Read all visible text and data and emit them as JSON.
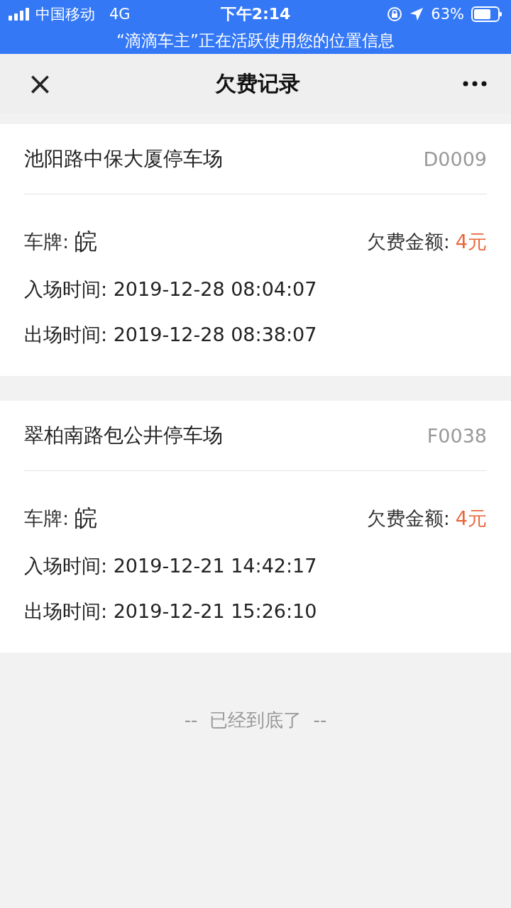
{
  "status_bar": {
    "carrier": "中国移动",
    "network": "4G",
    "time": "下午2:14",
    "battery": "63%",
    "location_banner": "“滴滴车主”正在活跃使用您的位置信息"
  },
  "nav": {
    "close": "×",
    "title": "欠费记录"
  },
  "records": [
    {
      "lot": "池阳路中保大厦停车场",
      "code": "D0009",
      "plate_label": "车牌:",
      "plate": "皖",
      "fee_label": "欠费金额:",
      "fee": "4元",
      "entry": "入场时间: 2019-12-28 08:04:07",
      "exit": "出场时间: 2019-12-28 08:38:07"
    },
    {
      "lot": "翠柏南路包公井停车场",
      "code": "F0038",
      "plate_label": "车牌:",
      "plate": "皖",
      "fee_label": "欠费金额:",
      "fee": "4元",
      "entry": "入场时间: 2019-12-21 14:42:17",
      "exit": "出场时间: 2019-12-21 15:26:10"
    }
  ],
  "footer": "--  已经到底了  --"
}
